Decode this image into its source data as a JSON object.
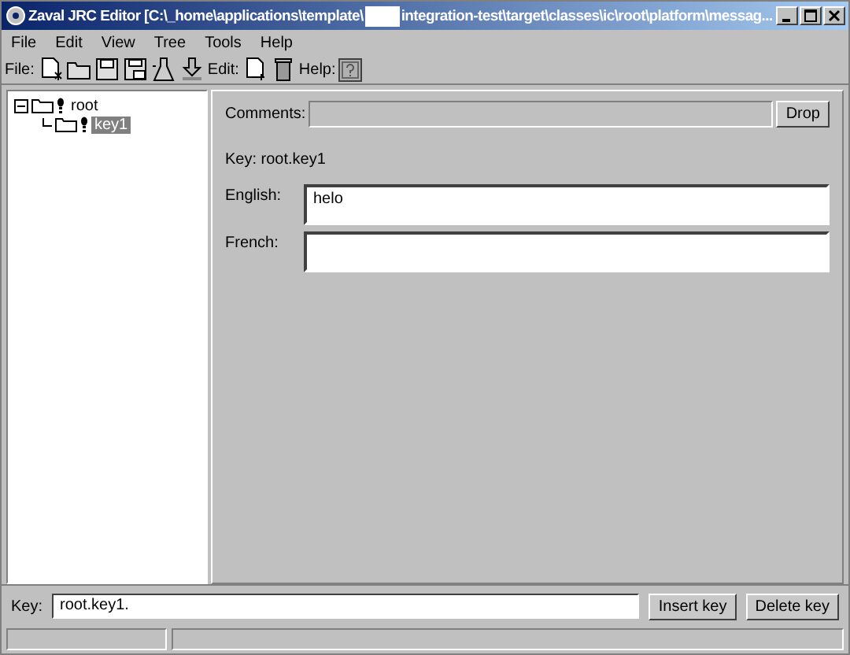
{
  "window": {
    "title_start": "Zaval JRC Editor [C:\\_home\\applications\\template\\",
    "title_end": "integration-test\\target\\classes\\ic\\root\\platform\\messag..."
  },
  "menu": [
    "File",
    "Edit",
    "View",
    "Tree",
    "Tools",
    "Help"
  ],
  "toolbar": {
    "file_label": "File:",
    "edit_label": "Edit:",
    "help_label": "Help:"
  },
  "tree": [
    {
      "label": "root",
      "selected": false,
      "expanded": true,
      "children": [
        {
          "label": "key1",
          "selected": true
        }
      ]
    }
  ],
  "editor": {
    "comments_label": "Comments:",
    "drop_button": "Drop",
    "key_text": "Key: root.key1",
    "languages": [
      {
        "label": "English:",
        "value": "helo"
      },
      {
        "label": "French:"
      }
    ]
  },
  "bottom": {
    "key_label": "Key:",
    "key_value": "root.key1.",
    "insert_button": "Insert key",
    "delete_button": "Delete key"
  }
}
